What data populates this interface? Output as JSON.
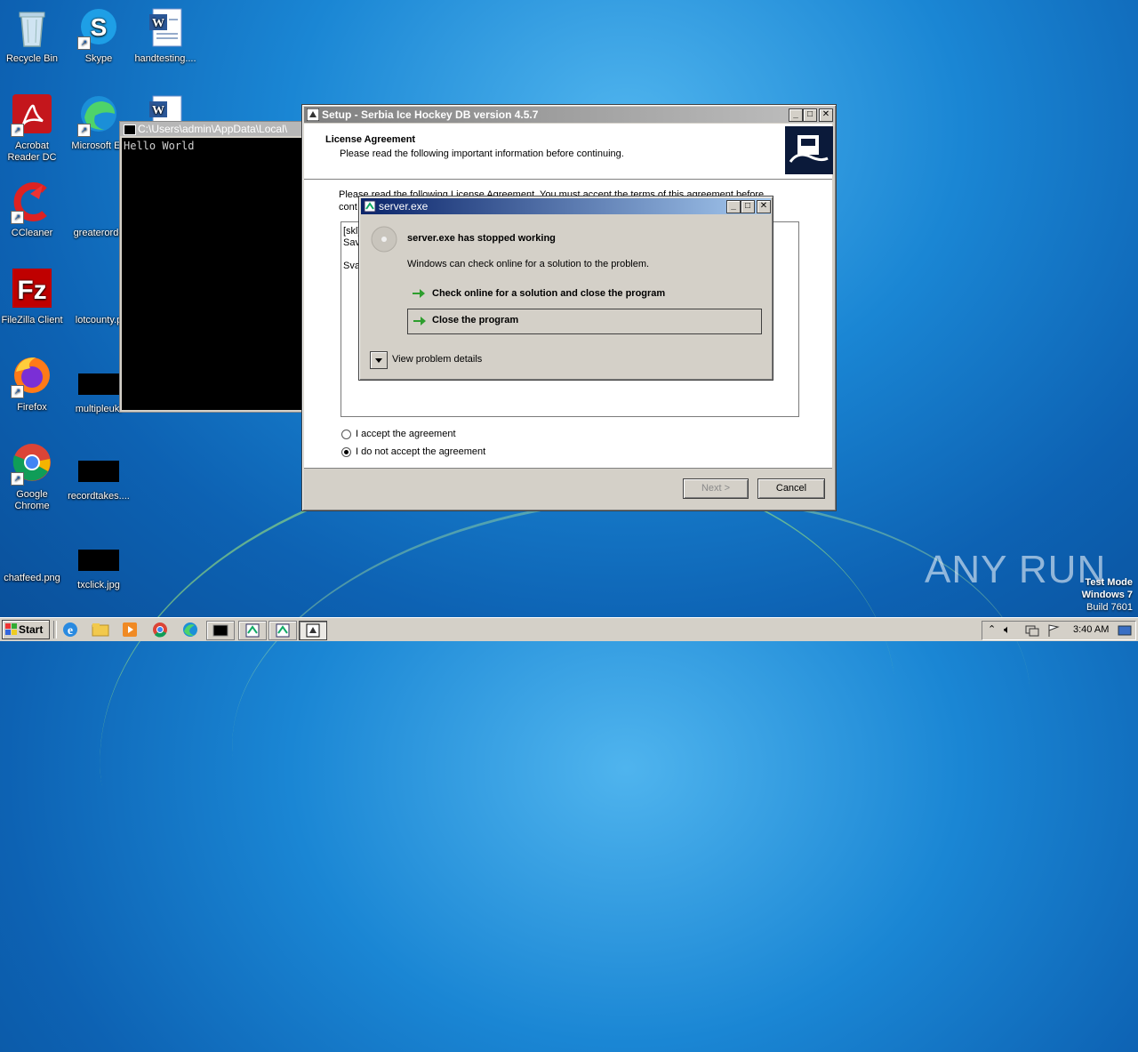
{
  "desktop": {
    "icons": [
      {
        "label": "Recycle Bin"
      },
      {
        "label": "Skype"
      },
      {
        "label": "handtesting...."
      },
      {
        "label": "Acrobat Reader DC"
      },
      {
        "label": "Microsoft Ed"
      },
      {
        "label": "CCleaner"
      },
      {
        "label": "greaterorde"
      },
      {
        "label": "FileZilla Client"
      },
      {
        "label": "lotcounty.p"
      },
      {
        "label": "Firefox"
      },
      {
        "label": "multipleuk."
      },
      {
        "label": "Google Chrome"
      },
      {
        "label": "recordtakes...."
      },
      {
        "label": "chatfeed.png"
      },
      {
        "label": "txclick.jpg"
      }
    ]
  },
  "console": {
    "title": "C:\\Users\\admin\\AppData\\Local\\",
    "output": "Hello World"
  },
  "setup": {
    "title": "Setup - Serbia Ice Hockey DB version 4.5.7",
    "heading": "License Agreement",
    "subheading": "Please read the following important information before continuing.",
    "intro_line1": "Please read the following License Agreement. You must accept the terms of this agreement before",
    "intro_line2": "cont",
    "license_line1": "[skl]",
    "license_line2": "Sav",
    "license_line3": "Sva",
    "accept_label": "I accept the agreement",
    "decline_label": "I do not accept the agreement",
    "selected": "decline",
    "next_label": "Next >",
    "cancel_label": "Cancel"
  },
  "error_dialog": {
    "title": "server.exe",
    "heading": "server.exe has stopped working",
    "message": "Windows can check online for a solution to the problem.",
    "option1": "Check online for a solution and close the program",
    "option2": "Close the program",
    "details": "View problem details"
  },
  "watermark": {
    "brand": "ANY RUN",
    "mode": "Test Mode",
    "os": "Windows 7",
    "build": "Build 7601"
  },
  "taskbar": {
    "start_label": "Start",
    "clock": "3:40 AM"
  },
  "colors": {
    "titlebar_active_start": "#0a246a",
    "titlebar_active_end": "#a6caf0",
    "titlebar_inactive": "#808080",
    "arrow_green": "#2e9e2e"
  }
}
